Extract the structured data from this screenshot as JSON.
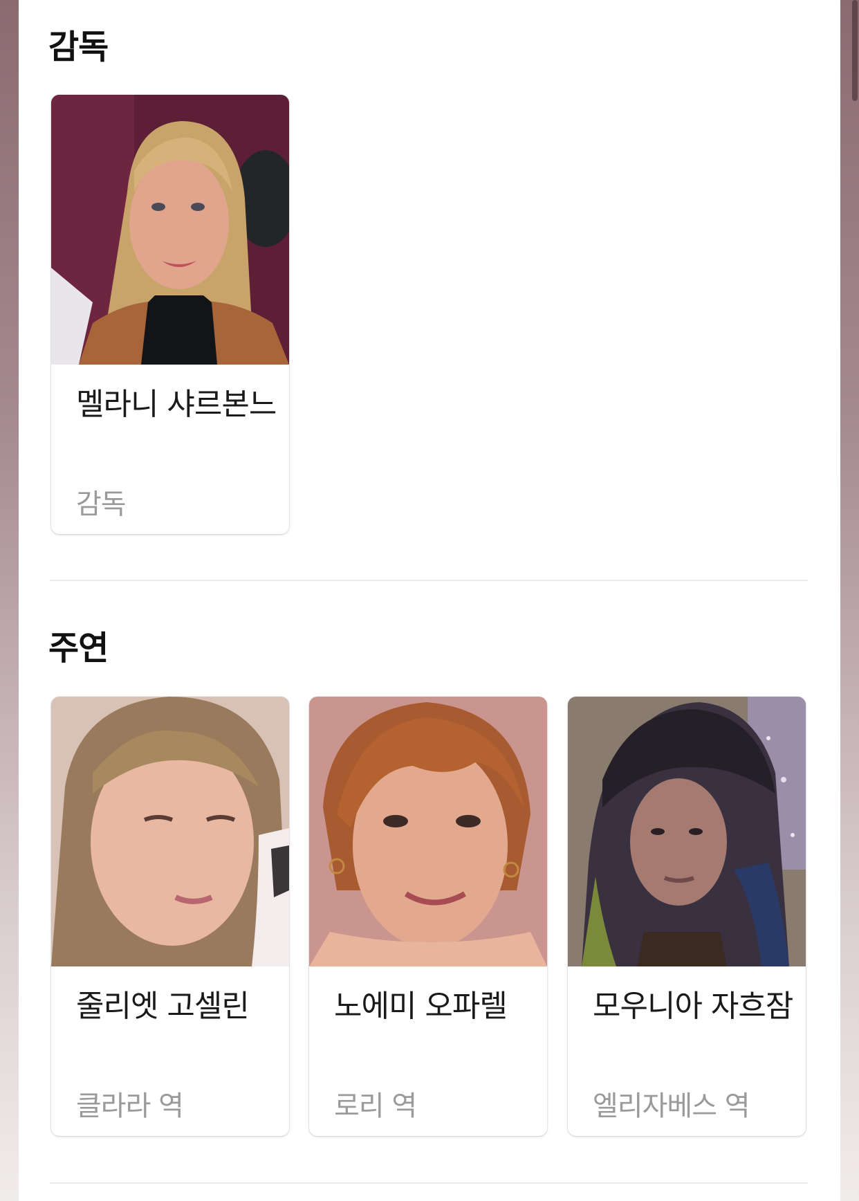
{
  "director_section": {
    "title": "감독",
    "people": [
      {
        "name": "멜라니 샤르본느",
        "role": "감독"
      }
    ]
  },
  "cast_section": {
    "title": "주연",
    "people": [
      {
        "name": "줄리엣 고셀린",
        "role": "클라라 역"
      },
      {
        "name": "노에미 오파렐",
        "role": "로리 역"
      },
      {
        "name": "모우니아 자흐잠",
        "role": "엘리자베스 역"
      }
    ]
  }
}
